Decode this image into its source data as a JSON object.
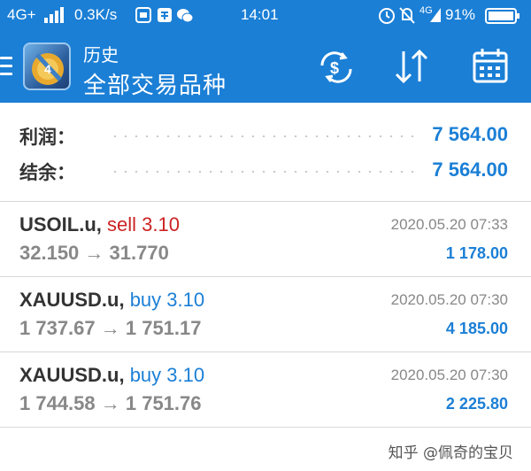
{
  "status_bar": {
    "network": "4G+",
    "speed": "0.3K/s",
    "time": "14:01",
    "network2": "4G",
    "battery": "91%"
  },
  "header": {
    "subtitle": "历史",
    "title": "全部交易品种",
    "icons": [
      "menu-icon",
      "app-logo",
      "currency-exchange-icon",
      "sort-icon",
      "calendar-icon"
    ]
  },
  "summary": {
    "profit_label": "利润：",
    "profit_value": "7 564.00",
    "balance_label": "结余：",
    "balance_value": "7 564.00"
  },
  "trades": [
    {
      "symbol": "USOIL.u,",
      "action": "sell 3.10",
      "side": "sell",
      "prices": "32.150 → 31.770",
      "time": "2020.05.20 07:33",
      "profit": "1 178.00"
    },
    {
      "symbol": "XAUUSD.u,",
      "action": "buy 3.10",
      "side": "buy",
      "prices": "1 737.67 → 1 751.17",
      "time": "2020.05.20 07:30",
      "profit": "4 185.00"
    },
    {
      "symbol": "XAUUSD.u,",
      "action": "buy 3.10",
      "side": "buy",
      "prices": "1 744.58 → 1 751.76",
      "time": "2020.05.20 07:30",
      "profit": "2 225.80"
    }
  ],
  "watermark": "知乎 @佩奇的宝贝",
  "colors": {
    "accent": "#1b7fd6",
    "sell": "#cc2222",
    "muted": "#888888"
  }
}
